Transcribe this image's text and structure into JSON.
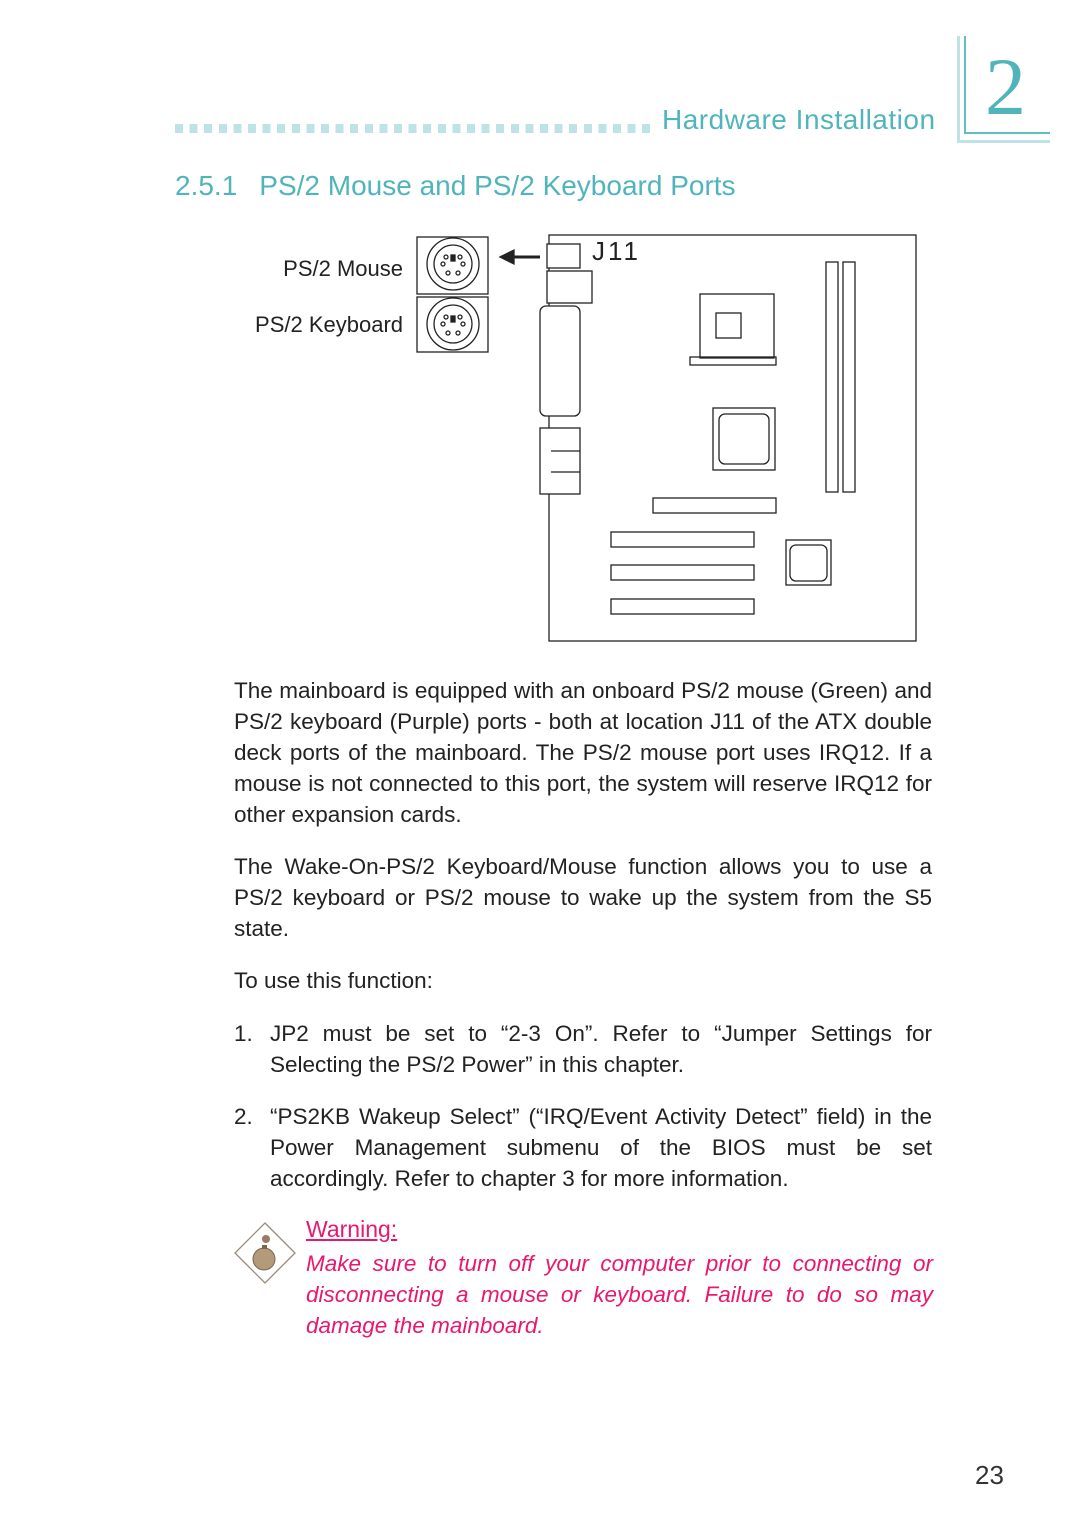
{
  "header": {
    "section": "Hardware Installation",
    "chapter": "2"
  },
  "title": {
    "number": "2.5.1",
    "text": "PS/2 Mouse and PS/2 Keyboard Ports"
  },
  "diagram": {
    "mouse_label": "PS/2 Mouse",
    "keyboard_label": "PS/2 Keyboard",
    "connector_label": "J11"
  },
  "body": {
    "p1": "The mainboard is equipped with an onboard PS/2 mouse (Green) and PS/2 keyboard (Purple) ports - both at location J11 of the ATX double deck ports of the mainboard. The PS/2 mouse port uses IRQ12. If a mouse is not connected to this port, the system will reserve IRQ12 for other expansion cards.",
    "p2": "The Wake-On-PS/2 Keyboard/Mouse function allows you to use a PS/2 keyboard or PS/2 mouse to wake up the system from the S5 state.",
    "p3": "To use this function:",
    "steps": [
      {
        "num": "1.",
        "text": "JP2 must be set to “2-3 On”. Refer to “Jumper Settings for Selecting the PS/2 Power” in this chapter."
      },
      {
        "num": "2.",
        "text": "“PS2KB Wakeup Select” (“IRQ/Event Activity Detect” field) in the Power Management submenu of the BIOS must be set accordingly. Refer to chapter 3 for more information."
      }
    ]
  },
  "warning": {
    "icon": "bomb-icon",
    "title": "Warning:",
    "text": "Make sure to turn off your computer prior to connecting or disconnecting a mouse or keyboard. Failure to do so may damage the mainboard."
  },
  "page_number": "23",
  "colors": {
    "accent": "#4fb5bb",
    "warning": "#e8176f"
  }
}
